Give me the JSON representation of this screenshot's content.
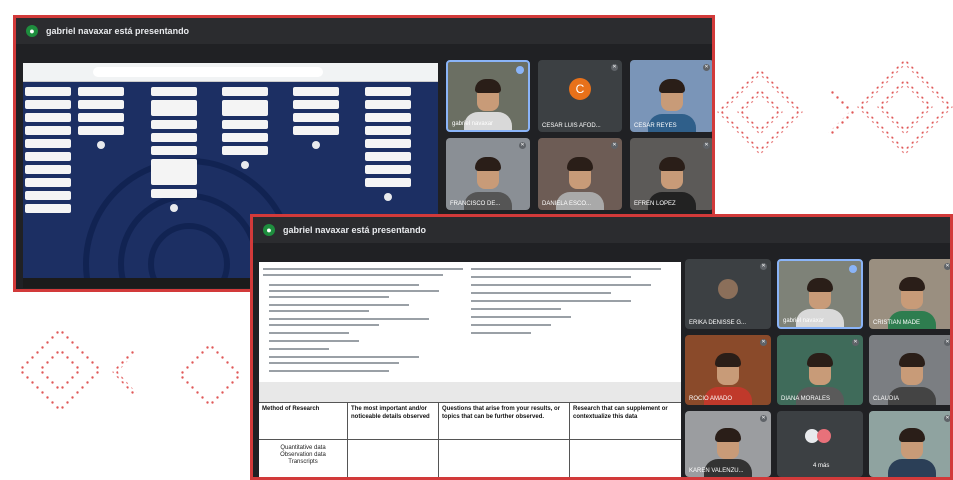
{
  "colors": {
    "accent": "#d23a3a",
    "meet_bg": "#202124",
    "tile_bg": "#3c4043"
  },
  "window1": {
    "title": "gabriel navaxar está presentando",
    "tiles": [
      {
        "name": "gabriel navaxar"
      },
      {
        "name": "CESAR LUIS AFOD...",
        "initial": "C"
      },
      {
        "name": "CESAR REYES"
      },
      {
        "name": "FRANCISCO DE..."
      },
      {
        "name": "DANIELA ESCO..."
      },
      {
        "name": "EFREN LOPEZ"
      }
    ]
  },
  "window2": {
    "title": "gabriel navaxar está presentando",
    "tiles": [
      {
        "name": "ERIKA DENISSE G..."
      },
      {
        "name": "gabriel navaxar"
      },
      {
        "name": "CRISTIAN MADE"
      },
      {
        "name": "ROCIO AMADO"
      },
      {
        "name": "DIANA MORALES"
      },
      {
        "name": "CLAUDIA"
      },
      {
        "name": "KAREN VALENZU..."
      },
      {
        "name": "4 más"
      },
      {
        "name": ""
      }
    ],
    "table": {
      "headers": [
        "Method of Research",
        "The most important and/or noticeable details observed",
        "Questions that arise from your results, or topics that can be further observed.",
        "Research that can supplement or contextualize this data"
      ],
      "first_cell": "Quantitative data\nObservation data\nTranscripts"
    }
  }
}
